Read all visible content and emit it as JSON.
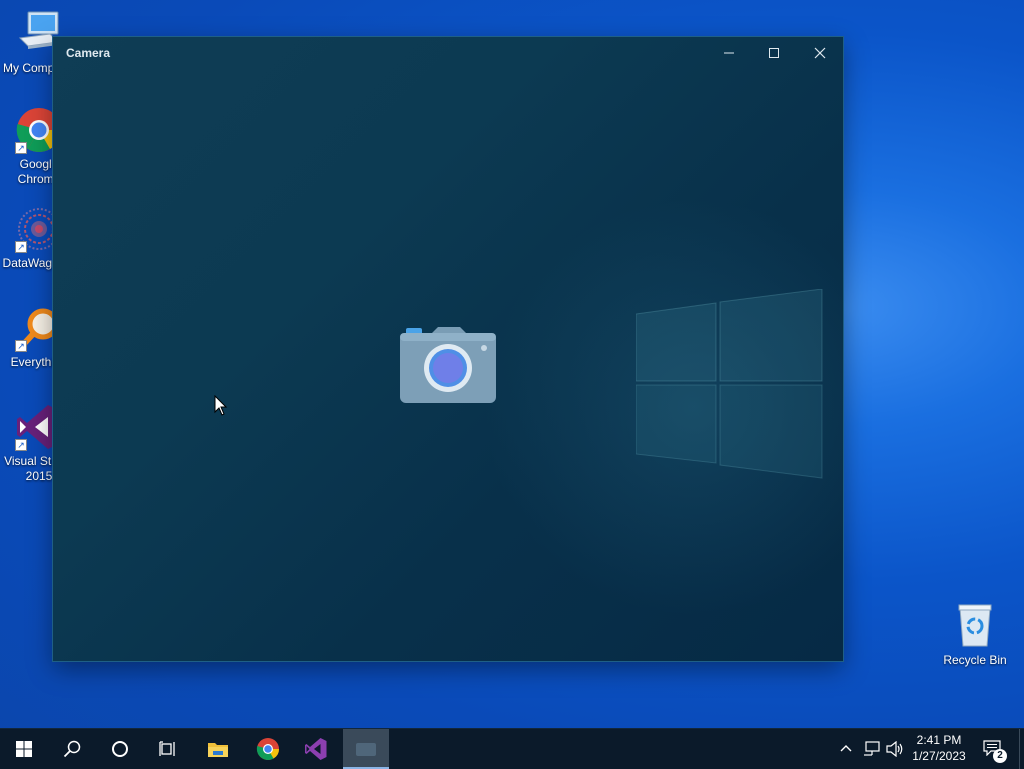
{
  "desktop_icons": [
    {
      "label": "My Computer",
      "icon": "computer-icon"
    },
    {
      "label": "Google Chrome",
      "icon": "chrome-icon"
    },
    {
      "label": "DataWagon...",
      "icon": "datawagon-icon"
    },
    {
      "label": "Everything",
      "icon": "everything-search-icon"
    },
    {
      "label": "Visual Studio 2015",
      "icon": "visual-studio-icon"
    },
    {
      "label": "Recycle Bin",
      "icon": "recycle-bin-icon"
    }
  ],
  "camera_window": {
    "title": "Camera",
    "center_icon": "camera-icon",
    "controls": [
      "minimize",
      "maximize",
      "close"
    ]
  },
  "taskbar": {
    "buttons": [
      "start",
      "search",
      "cortana",
      "task-view",
      "file-explorer",
      "chrome",
      "visual-studio",
      "camera"
    ],
    "tray_icons": [
      "show-hidden-icons",
      "network",
      "volume"
    ],
    "time": "2:41 PM",
    "date": "1/27/2023",
    "notification_count": "2"
  },
  "colors": {
    "accent": "#0b55c9",
    "window_bg": "#0c3a52",
    "taskbar_bg": "#0b1a2a"
  }
}
